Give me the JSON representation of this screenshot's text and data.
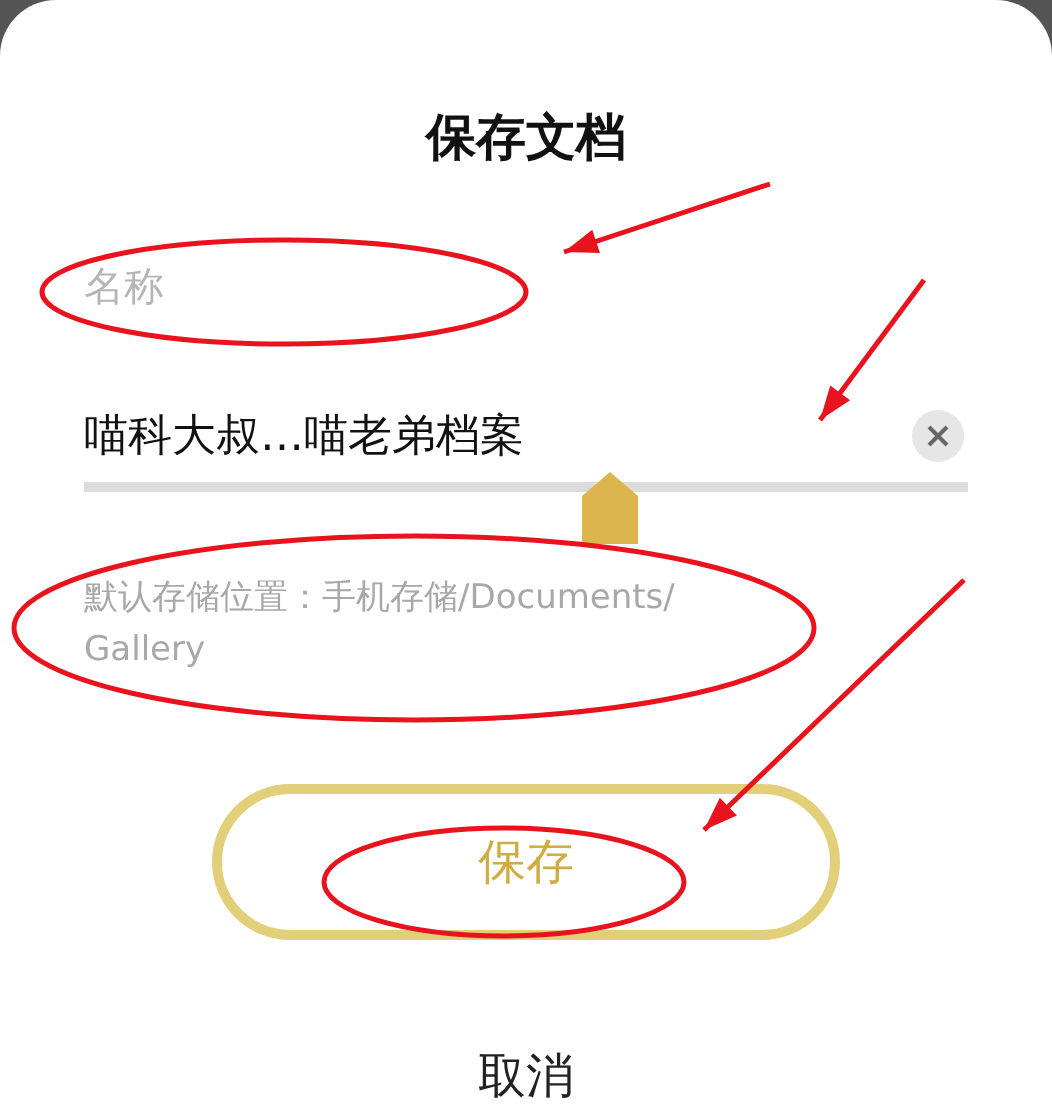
{
  "dialog": {
    "title": "保存文档"
  },
  "name_field": {
    "placeholder": "名称",
    "value": "喵科大叔…喵老弟档案"
  },
  "hint": "默认存储位置：手机存储/Documents/ Gallery",
  "buttons": [
    {
      "label": "保存",
      "kind": "primary"
    },
    {
      "label": "取消",
      "kind": "text"
    }
  ]
}
